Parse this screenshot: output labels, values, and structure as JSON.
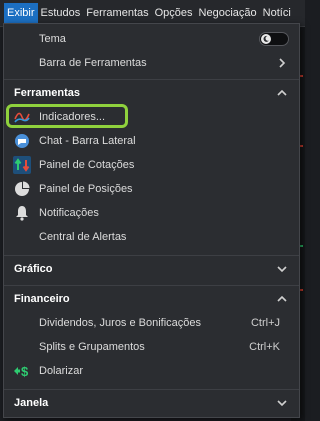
{
  "menubar": {
    "items": [
      "Exibir",
      "Estudos",
      "Ferramentas",
      "Opções",
      "Negociação",
      "Notíci"
    ]
  },
  "menu": {
    "tema": "Tema",
    "barra": "Barra de Ferramentas",
    "sections": {
      "ferramentas": "Ferramentas",
      "grafico": "Gráfico",
      "financeiro": "Financeiro",
      "janela": "Janela"
    },
    "ferramentas_items": [
      {
        "label": "Indicadores...",
        "icon": "line-chart-icon"
      },
      {
        "label": "Chat - Barra Lateral",
        "icon": "chat-icon"
      },
      {
        "label": "Painel de Cotações",
        "icon": "quotes-arrows-icon"
      },
      {
        "label": "Painel de Posições",
        "icon": "pie-chart-icon"
      },
      {
        "label": "Notificações",
        "icon": "bell-icon"
      },
      {
        "label": "Central de Alertas",
        "icon": ""
      }
    ],
    "financeiro_items": [
      {
        "label": "Dividendos, Juros e Bonificações",
        "shortcut": "Ctrl+J"
      },
      {
        "label": "Splits e Grupamentos",
        "shortcut": "Ctrl+K"
      },
      {
        "label": "Dolarizar",
        "shortcut": "",
        "icon": "dollar-arrow-icon"
      }
    ]
  },
  "colors": {
    "accent": "#1c6fc2",
    "highlight": "#8fd13d",
    "menu_bg": "#2b2d31"
  }
}
